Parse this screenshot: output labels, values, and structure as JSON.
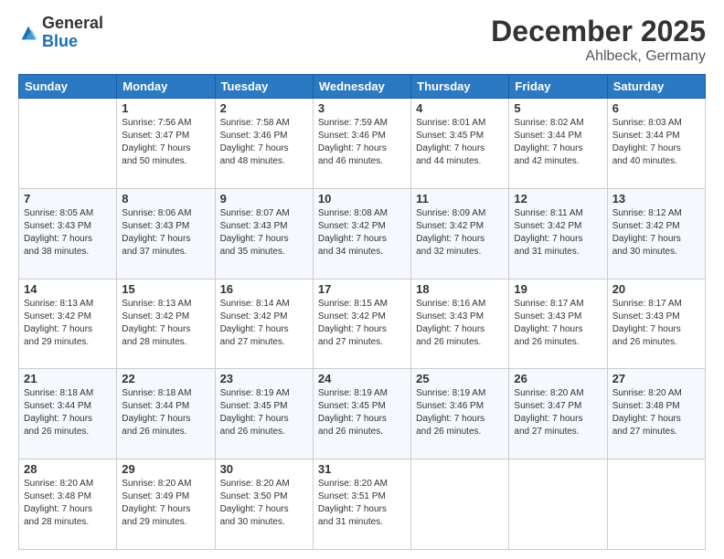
{
  "logo": {
    "general": "General",
    "blue": "Blue"
  },
  "title": "December 2025",
  "location": "Ahlbeck, Germany",
  "days_header": [
    "Sunday",
    "Monday",
    "Tuesday",
    "Wednesday",
    "Thursday",
    "Friday",
    "Saturday"
  ],
  "weeks": [
    [
      {
        "day": "",
        "info": ""
      },
      {
        "day": "1",
        "info": "Sunrise: 7:56 AM\nSunset: 3:47 PM\nDaylight: 7 hours\nand 50 minutes."
      },
      {
        "day": "2",
        "info": "Sunrise: 7:58 AM\nSunset: 3:46 PM\nDaylight: 7 hours\nand 48 minutes."
      },
      {
        "day": "3",
        "info": "Sunrise: 7:59 AM\nSunset: 3:46 PM\nDaylight: 7 hours\nand 46 minutes."
      },
      {
        "day": "4",
        "info": "Sunrise: 8:01 AM\nSunset: 3:45 PM\nDaylight: 7 hours\nand 44 minutes."
      },
      {
        "day": "5",
        "info": "Sunrise: 8:02 AM\nSunset: 3:44 PM\nDaylight: 7 hours\nand 42 minutes."
      },
      {
        "day": "6",
        "info": "Sunrise: 8:03 AM\nSunset: 3:44 PM\nDaylight: 7 hours\nand 40 minutes."
      }
    ],
    [
      {
        "day": "7",
        "info": "Sunrise: 8:05 AM\nSunset: 3:43 PM\nDaylight: 7 hours\nand 38 minutes."
      },
      {
        "day": "8",
        "info": "Sunrise: 8:06 AM\nSunset: 3:43 PM\nDaylight: 7 hours\nand 37 minutes."
      },
      {
        "day": "9",
        "info": "Sunrise: 8:07 AM\nSunset: 3:43 PM\nDaylight: 7 hours\nand 35 minutes."
      },
      {
        "day": "10",
        "info": "Sunrise: 8:08 AM\nSunset: 3:42 PM\nDaylight: 7 hours\nand 34 minutes."
      },
      {
        "day": "11",
        "info": "Sunrise: 8:09 AM\nSunset: 3:42 PM\nDaylight: 7 hours\nand 32 minutes."
      },
      {
        "day": "12",
        "info": "Sunrise: 8:11 AM\nSunset: 3:42 PM\nDaylight: 7 hours\nand 31 minutes."
      },
      {
        "day": "13",
        "info": "Sunrise: 8:12 AM\nSunset: 3:42 PM\nDaylight: 7 hours\nand 30 minutes."
      }
    ],
    [
      {
        "day": "14",
        "info": "Sunrise: 8:13 AM\nSunset: 3:42 PM\nDaylight: 7 hours\nand 29 minutes."
      },
      {
        "day": "15",
        "info": "Sunrise: 8:13 AM\nSunset: 3:42 PM\nDaylight: 7 hours\nand 28 minutes."
      },
      {
        "day": "16",
        "info": "Sunrise: 8:14 AM\nSunset: 3:42 PM\nDaylight: 7 hours\nand 27 minutes."
      },
      {
        "day": "17",
        "info": "Sunrise: 8:15 AM\nSunset: 3:42 PM\nDaylight: 7 hours\nand 27 minutes."
      },
      {
        "day": "18",
        "info": "Sunrise: 8:16 AM\nSunset: 3:43 PM\nDaylight: 7 hours\nand 26 minutes."
      },
      {
        "day": "19",
        "info": "Sunrise: 8:17 AM\nSunset: 3:43 PM\nDaylight: 7 hours\nand 26 minutes."
      },
      {
        "day": "20",
        "info": "Sunrise: 8:17 AM\nSunset: 3:43 PM\nDaylight: 7 hours\nand 26 minutes."
      }
    ],
    [
      {
        "day": "21",
        "info": "Sunrise: 8:18 AM\nSunset: 3:44 PM\nDaylight: 7 hours\nand 26 minutes."
      },
      {
        "day": "22",
        "info": "Sunrise: 8:18 AM\nSunset: 3:44 PM\nDaylight: 7 hours\nand 26 minutes."
      },
      {
        "day": "23",
        "info": "Sunrise: 8:19 AM\nSunset: 3:45 PM\nDaylight: 7 hours\nand 26 minutes."
      },
      {
        "day": "24",
        "info": "Sunrise: 8:19 AM\nSunset: 3:45 PM\nDaylight: 7 hours\nand 26 minutes."
      },
      {
        "day": "25",
        "info": "Sunrise: 8:19 AM\nSunset: 3:46 PM\nDaylight: 7 hours\nand 26 minutes."
      },
      {
        "day": "26",
        "info": "Sunrise: 8:20 AM\nSunset: 3:47 PM\nDaylight: 7 hours\nand 27 minutes."
      },
      {
        "day": "27",
        "info": "Sunrise: 8:20 AM\nSunset: 3:48 PM\nDaylight: 7 hours\nand 27 minutes."
      }
    ],
    [
      {
        "day": "28",
        "info": "Sunrise: 8:20 AM\nSunset: 3:48 PM\nDaylight: 7 hours\nand 28 minutes."
      },
      {
        "day": "29",
        "info": "Sunrise: 8:20 AM\nSunset: 3:49 PM\nDaylight: 7 hours\nand 29 minutes."
      },
      {
        "day": "30",
        "info": "Sunrise: 8:20 AM\nSunset: 3:50 PM\nDaylight: 7 hours\nand 30 minutes."
      },
      {
        "day": "31",
        "info": "Sunrise: 8:20 AM\nSunset: 3:51 PM\nDaylight: 7 hours\nand 31 minutes."
      },
      {
        "day": "",
        "info": ""
      },
      {
        "day": "",
        "info": ""
      },
      {
        "day": "",
        "info": ""
      }
    ]
  ]
}
